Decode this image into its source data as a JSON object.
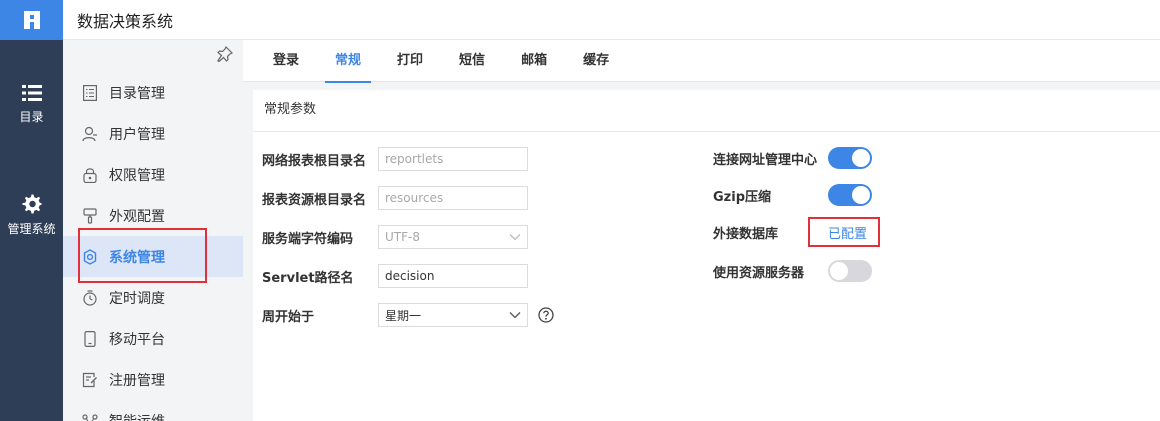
{
  "app": {
    "title": "数据决策系统"
  },
  "rail": {
    "items": [
      {
        "label": "目录"
      },
      {
        "label": "管理系统"
      }
    ]
  },
  "sidebar": {
    "items": [
      {
        "label": "目录管理",
        "icon": "catalog-icon"
      },
      {
        "label": "用户管理",
        "icon": "user-icon"
      },
      {
        "label": "权限管理",
        "icon": "lock-icon"
      },
      {
        "label": "外观配置",
        "icon": "brush-icon"
      },
      {
        "label": "系统管理",
        "icon": "gear-icon",
        "active": true
      },
      {
        "label": "定时调度",
        "icon": "timer-icon"
      },
      {
        "label": "移动平台",
        "icon": "mobile-icon"
      },
      {
        "label": "注册管理",
        "icon": "register-icon"
      },
      {
        "label": "智能运维",
        "icon": "ops-icon"
      }
    ]
  },
  "tabs": [
    {
      "label": "登录"
    },
    {
      "label": "常规",
      "active": true
    },
    {
      "label": "打印"
    },
    {
      "label": "短信"
    },
    {
      "label": "邮箱"
    },
    {
      "label": "缓存"
    }
  ],
  "panel": {
    "title": "常规参数",
    "left_fields": [
      {
        "label": "网络报表根目录名",
        "value": "reportlets",
        "disabled": true
      },
      {
        "label": "报表资源根目录名",
        "value": "resources",
        "disabled": true
      },
      {
        "label": "服务端字符编码",
        "value": "UTF-8",
        "disabled": true,
        "select": true
      },
      {
        "label": "Servlet路径名",
        "value": "decision"
      },
      {
        "label": "周开始于",
        "value": "星期一",
        "select": true
      }
    ],
    "right_fields": [
      {
        "label": "连接网址管理中心",
        "toggle": true,
        "state": "on"
      },
      {
        "label": "Gzip压缩",
        "toggle": true,
        "state": "on"
      },
      {
        "label": "外接数据库",
        "link": "已配置"
      },
      {
        "label": "使用资源服务器",
        "toggle": true,
        "state": "off"
      }
    ]
  },
  "colors": {
    "accent": "#3d86e6",
    "rail": "#2e3e57",
    "highlight": "#e0303a"
  }
}
